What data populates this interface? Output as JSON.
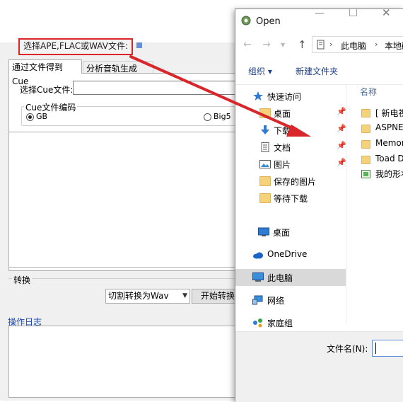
{
  "background_app": {
    "browse_button_label": "选择APE,FLAC或WAV文件:",
    "tabs": [
      {
        "label": "通过文件得到Cue"
      },
      {
        "label": "分析音轨生成Cue"
      }
    ],
    "cue_file_label": "选择Cue文件:",
    "cue_file_value": "",
    "encoding_group_title": "Cue文件编码",
    "encoding_options": [
      {
        "label": "GB",
        "selected": true
      },
      {
        "label": "Big5",
        "selected": false
      }
    ],
    "convert_group_title": "转换",
    "convert_mode_selected": "切割转换为Wav",
    "start_button_label": "开始转换",
    "log_label": "操作日志",
    "highlight_color": "#d9262a"
  },
  "dialog": {
    "title": "Open",
    "address": {
      "parts": [
        "此电脑",
        "本地磁"
      ]
    },
    "toolbar": {
      "organize_label": "组织 ▾",
      "new_folder_label": "新建文件夹"
    },
    "nav_pane": {
      "quick_access_label": "快速访问",
      "quick_items": [
        {
          "label": "桌面",
          "icon": "desktop-folder-icon",
          "pinned": true
        },
        {
          "label": "下载",
          "icon": "download-arrow-icon",
          "pinned": true
        },
        {
          "label": "文档",
          "icon": "document-icon",
          "pinned": true
        },
        {
          "label": "图片",
          "icon": "pictures-icon",
          "pinned": true
        },
        {
          "label": "保存的图片",
          "icon": "folder-icon",
          "pinned": false
        },
        {
          "label": "等待下载",
          "icon": "folder-icon",
          "pinned": false
        }
      ],
      "desktop_label": "桌面",
      "onedrive_label": "OneDrive",
      "this_pc_label": "此电脑",
      "network_label": "网络",
      "homegroup_label": "家庭组"
    },
    "content": {
      "column_header": "名称",
      "items": [
        {
          "name": "[ 新电视",
          "icon": "folder-icon"
        },
        {
          "name": "ASPNET",
          "icon": "folder-icon"
        },
        {
          "name": "Memory",
          "icon": "folder-icon"
        },
        {
          "name": "Toad Data",
          "icon": "folder-icon"
        },
        {
          "name": "我的形状",
          "icon": "library-icon"
        }
      ]
    },
    "footer": {
      "filename_label": "文件名(N):",
      "filename_value": ""
    }
  },
  "annotation": {
    "arrow_color": "#d9262a"
  }
}
